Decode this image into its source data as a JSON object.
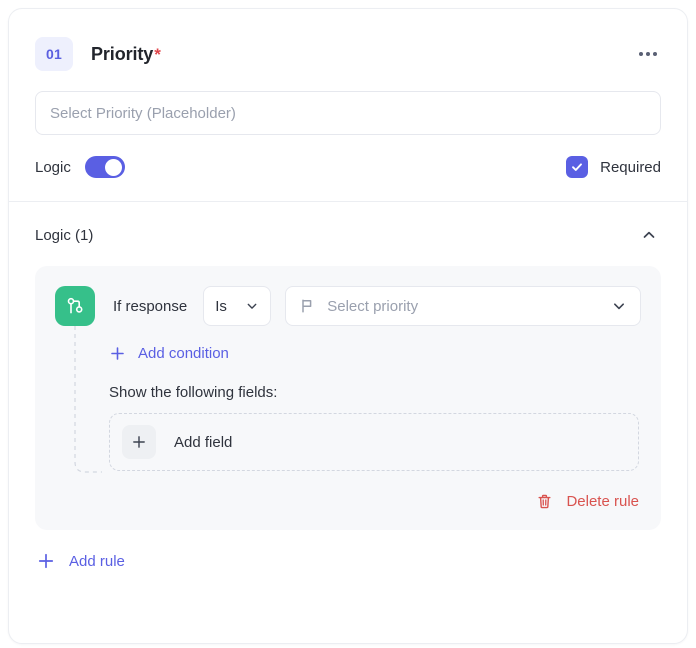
{
  "field": {
    "index": "01",
    "title": "Priority",
    "required_marker": "*",
    "menu_icon": "ellipsis-icon",
    "input_placeholder": "Select Priority (Placeholder)",
    "logic_label": "Logic",
    "logic_enabled": true,
    "required_label": "Required",
    "required_checked": true
  },
  "logic": {
    "section_title": "Logic (1)",
    "collapse_icon": "chevron-up-icon",
    "rule": {
      "branch_icon": "git-branch-icon",
      "if_label": "If response",
      "operator": "Is",
      "operator_icon": "chevron-down-icon",
      "value_icon": "flag-icon",
      "value_placeholder": "Select priority",
      "value_chevron": "chevron-down-icon",
      "add_condition_label": "Add condition",
      "add_condition_icon": "plus-icon",
      "show_fields_label": "Show the following fields:",
      "add_field_label": "Add field",
      "add_field_icon": "plus-icon",
      "delete_label": "Delete rule",
      "delete_icon": "trash-icon"
    },
    "add_rule_label": "Add rule",
    "add_rule_icon": "plus-icon"
  },
  "colors": {
    "accent": "#5a5fe3",
    "branch": "#36c08a",
    "danger": "#d9534f",
    "badge_bg": "#eef0fd",
    "rule_bg": "#f7f8fa"
  }
}
